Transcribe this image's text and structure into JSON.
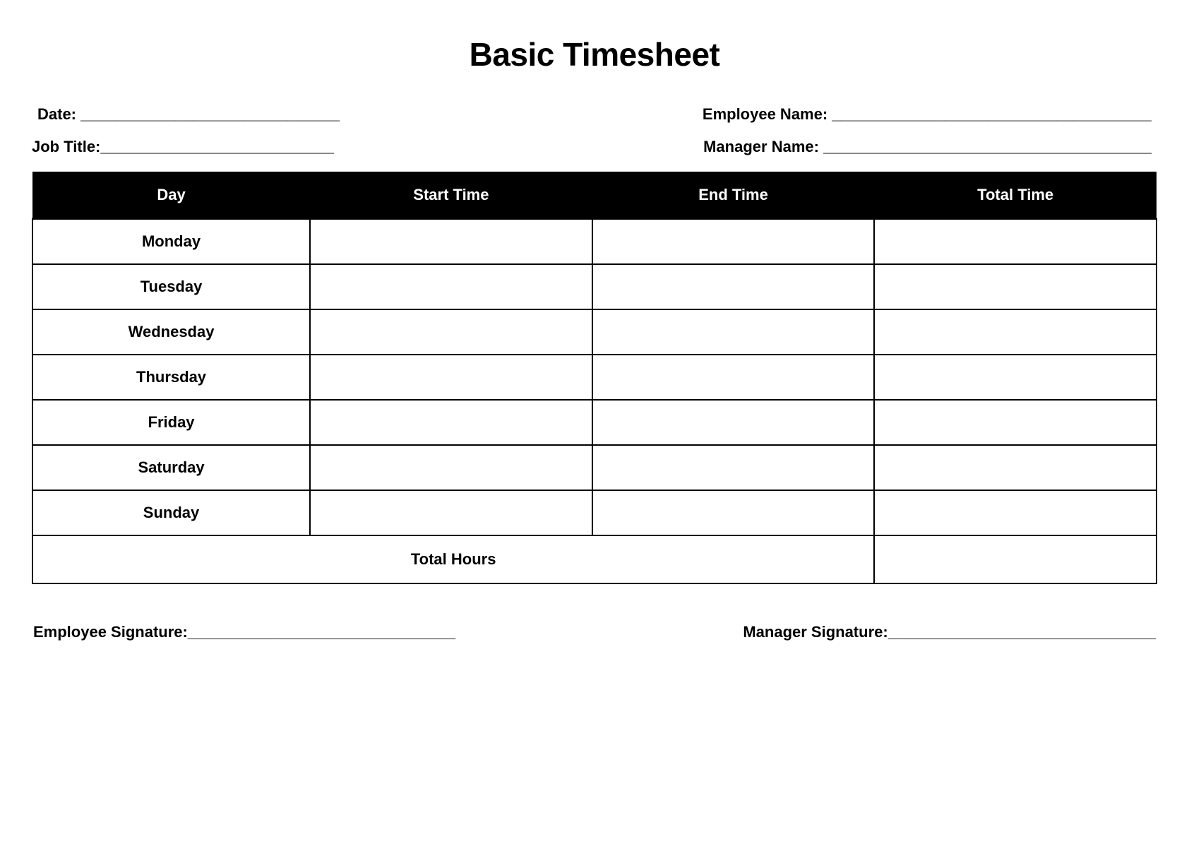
{
  "title": "Basic Timesheet",
  "info": {
    "date_label": "Date: ______________________________",
    "employee_name_label": "Employee Name: _____________________________________",
    "job_title_label": "Job Title:___________________________",
    "manager_name_label": "Manager Name: ______________________________________"
  },
  "table": {
    "headers": {
      "day": "Day",
      "start": "Start Time",
      "end": "End Time",
      "total": "Total Time"
    },
    "rows": [
      {
        "day": "Monday",
        "start": "",
        "end": "",
        "total": ""
      },
      {
        "day": "Tuesday",
        "start": "",
        "end": "",
        "total": ""
      },
      {
        "day": "Wednesday",
        "start": "",
        "end": "",
        "total": ""
      },
      {
        "day": "Thursday",
        "start": "",
        "end": "",
        "total": ""
      },
      {
        "day": "Friday",
        "start": "",
        "end": "",
        "total": ""
      },
      {
        "day": "Saturday",
        "start": "",
        "end": "",
        "total": ""
      },
      {
        "day": "Sunday",
        "start": "",
        "end": "",
        "total": ""
      }
    ],
    "footer_label": "Total Hours",
    "footer_value": ""
  },
  "signatures": {
    "employee": "Employee Signature:_______________________________",
    "manager": "Manager Signature:_______________________________"
  }
}
